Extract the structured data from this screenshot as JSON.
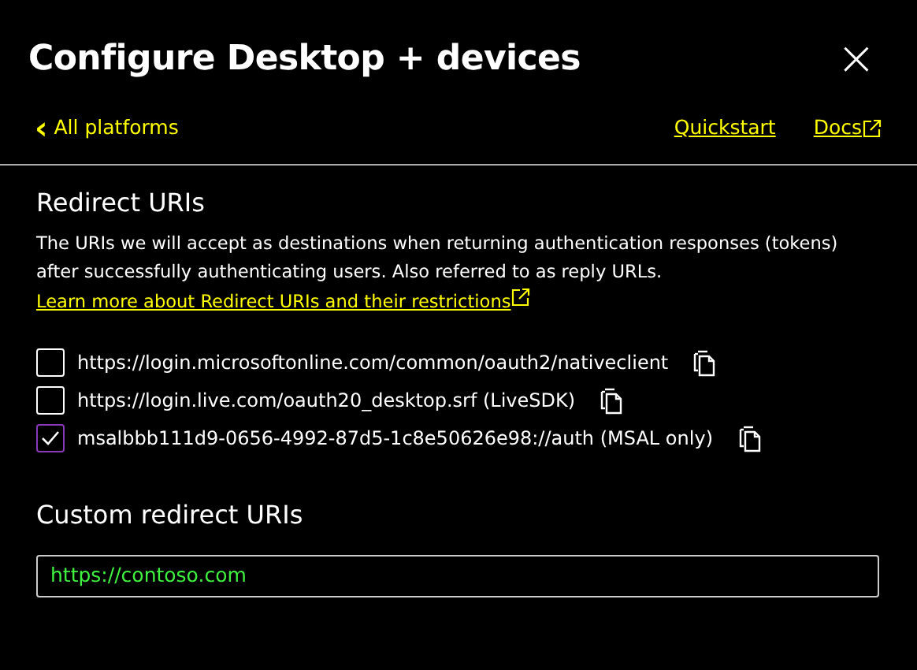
{
  "panel": {
    "title": "Configure Desktop + devices",
    "close": "×"
  },
  "nav": {
    "back": "All platforms",
    "back_icon": "‹",
    "links": [
      {
        "label": "Quickstart",
        "external": false
      },
      {
        "label": "Docs",
        "external": true
      }
    ]
  },
  "redirect": {
    "heading": "Redirect URIs",
    "description": "The URIs we will accept as destinations when returning authentication responses (tokens) after successfully authenticating users. Also referred to as reply URLs.",
    "link": "Learn more about Redirect URIs and their restrictions",
    "uris": [
      {
        "label": "https://login.microsoftonline.com/common/oauth2/nativeclient",
        "checked": false
      },
      {
        "label": "https://login.live.com/oauth20_desktop.srf (LiveSDK)",
        "checked": false
      },
      {
        "label": "msalbbb111d9-0656-4992-87d5-1c8e50626e98://auth (MSAL only)",
        "checked": true
      }
    ]
  },
  "custom": {
    "heading": "Custom redirect URIs",
    "value": "https://contoso.com"
  }
}
